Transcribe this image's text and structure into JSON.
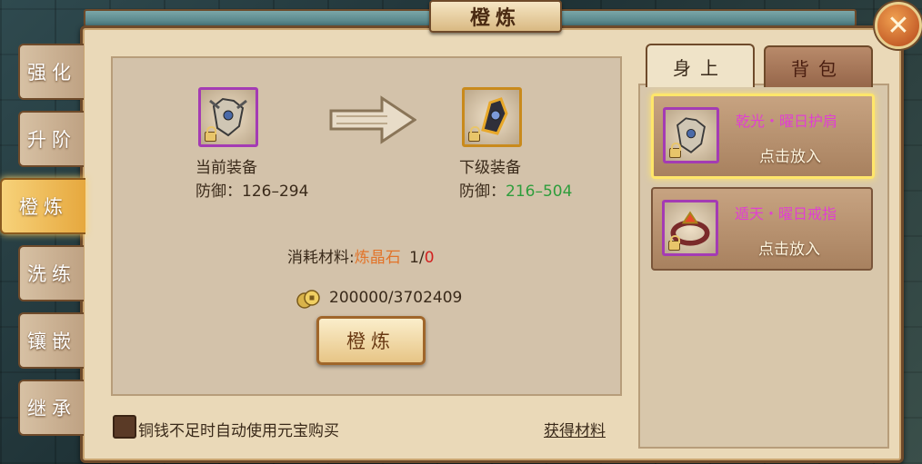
{
  "window": {
    "title": "橙炼",
    "close_icon": "close-x-icon"
  },
  "sidebar": {
    "tabs": [
      {
        "label": "强化",
        "active": false
      },
      {
        "label": "升阶",
        "active": false
      },
      {
        "label": "橙炼",
        "active": true
      },
      {
        "label": "洗练",
        "active": false
      },
      {
        "label": "镶嵌",
        "active": false
      },
      {
        "label": "继承",
        "active": false
      }
    ]
  },
  "refine": {
    "current": {
      "label": "当前装备",
      "stat_label": "防御：",
      "stat_value": "126–294",
      "item_icon": "shoulder-armor-icon"
    },
    "next": {
      "label": "下级装备",
      "stat_label": "防御：",
      "stat_value": "216–504",
      "item_icon": "orange-shoulder-armor-icon"
    },
    "material": {
      "label": "消耗材料:",
      "name": "炼晶石",
      "have": "1",
      "sep": "/",
      "need": "0"
    },
    "cost": {
      "value": "200000/3702409",
      "icon": "copper-coin-icon"
    },
    "button_label": "橙炼",
    "auto_buy_label": "铜钱不足时自动使用元宝购买",
    "get_material_label": "获得材料"
  },
  "inventory": {
    "tabs": [
      {
        "label": "身上",
        "active": true
      },
      {
        "label": "背包",
        "active": false
      }
    ],
    "items": [
      {
        "name": "乾光・曜日护肩",
        "action": "点击放入",
        "selected": true,
        "icon": "shoulder-armor-icon"
      },
      {
        "name": "遁天・曜日戒指",
        "action": "点击放入",
        "selected": false,
        "icon": "ring-icon"
      }
    ]
  },
  "colors": {
    "accent_gold": "#e6a83e",
    "stat_green": "#2e9d3c",
    "material_orange": "#e2742a",
    "missing_red": "#d21f1f",
    "item_purple": "#e040d0"
  }
}
